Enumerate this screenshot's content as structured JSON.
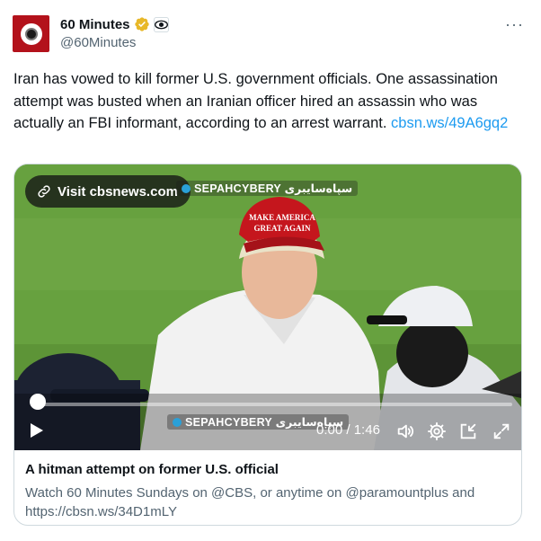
{
  "author": {
    "display_name": "60 Minutes",
    "handle": "@60Minutes",
    "avatar_icon": "60-minutes-stopwatch-logo",
    "verified_icon": "gold-verified-badge",
    "affiliate_icon": "cbs-eye-affiliate-badge"
  },
  "more_label": "···",
  "tweet": {
    "text": "Iran has vowed to kill former U.S. government officials. One assassination attempt was busted when an Iranian officer hired an assassin who was actually an FBI informant, according to an arrest warrant. ",
    "link": "cbsn.ws/49A6gq2"
  },
  "video": {
    "visit_label": "Visit cbsnews.com",
    "watermark_top": "SEPAHCYBERY سپاه‌سایبری",
    "watermark_bottom": "SEPAHCYBERY سپاه‌سایبری",
    "current_time": "0:00",
    "time_separator": " / ",
    "duration": "1:46",
    "progress_fraction": 0.0,
    "controls": [
      "play-icon",
      "volume-icon",
      "settings-icon",
      "picture-in-picture-icon",
      "fullscreen-icon"
    ]
  },
  "card": {
    "title": "A hitman attempt on former U.S. official",
    "description": "Watch 60 Minutes Sundays on @CBS, or anytime on @paramountplus and https://cbsn.ws/34D1mLY"
  },
  "colors": {
    "link": "#1d9bf0",
    "secondary_text": "#536471",
    "avatar_bg": "#b3121b",
    "verified_gold": "#e8b829"
  }
}
